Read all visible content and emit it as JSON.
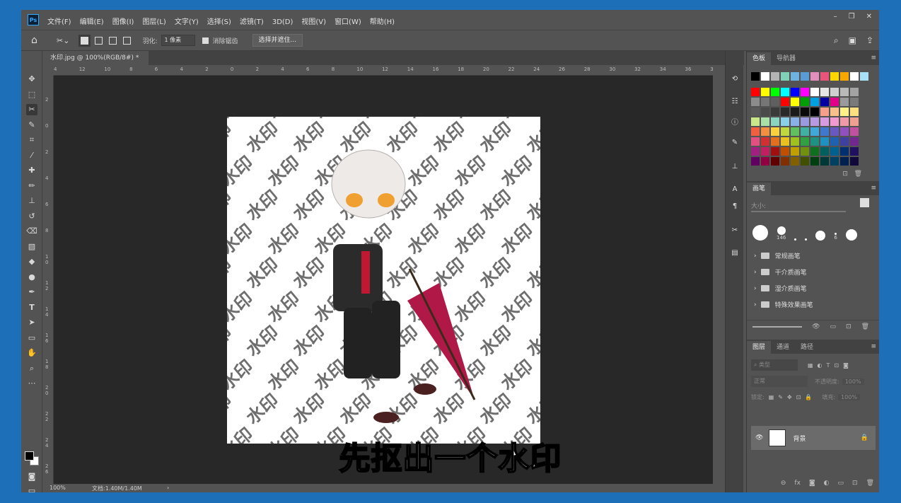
{
  "app": {
    "logo": "Ps",
    "menu": [
      "文件(F)",
      "编辑(E)",
      "图像(I)",
      "图层(L)",
      "文字(Y)",
      "选择(S)",
      "滤镜(T)",
      "3D(D)",
      "视图(V)",
      "窗口(W)",
      "帮助(H)"
    ]
  },
  "options": {
    "feather_label": "羽化:",
    "feather_value": "1 像素",
    "antialias_label": "消除锯齿",
    "select_mask_button": "选择并遮住..."
  },
  "document": {
    "tab_title": "水印.jpg @ 100%(RGB/8#) *",
    "zoom": "100%",
    "doc_size": "文档:1.40M/1.40M",
    "watermark_text": "水印"
  },
  "ruler_h": [
    "4",
    "12",
    "10",
    "8",
    "6",
    "4",
    "2",
    "0",
    "2",
    "4",
    "6",
    "8",
    "10",
    "12",
    "14",
    "16",
    "18",
    "20",
    "22",
    "24",
    "26",
    "28",
    "30",
    "32",
    "34",
    "36",
    "3"
  ],
  "ruler_v": [
    "2",
    "0",
    "2",
    "4",
    "6",
    "8",
    "1 0",
    "1 2",
    "1 4",
    "1 6",
    "1 8",
    "2 0",
    "2 2",
    "2 4",
    "2 6"
  ],
  "swatches_panel": {
    "tabs": [
      "色板",
      "导航器"
    ],
    "top_row": [
      "#000000",
      "#ffffff",
      "#b4b4b4",
      "#7fd1b8",
      "#6fb2e2",
      "#5a9bd5",
      "#e38fbd",
      "#e8557b",
      "#ffd500",
      "#f7a700",
      "#ffffff",
      "#a7e0f7"
    ],
    "grid": [
      [
        "#ff0000",
        "#ffff00",
        "#00ff00",
        "#00ffff",
        "#0000ff",
        "#ff00ff",
        "#ffffff",
        "#e6e6e6",
        "#d0d0d0",
        "#b9b9b9",
        "#a3a3a3"
      ],
      [
        "#8c8c8c",
        "#767676",
        "#5f5f5f",
        "#ff0000",
        "#ffff00",
        "#00a000",
        "#00a0e0",
        "#0000a0",
        "#e0008a",
        "#9a9a9a",
        "#7a7a7a"
      ],
      [
        "#5a5a5a",
        "#4a4a4a",
        "#3a3a3a",
        "#2a2a2a",
        "#1a1a1a",
        "#0a0a0a",
        "#000000",
        "#f4a08a",
        "#f8c08a",
        "#fff08a",
        "#ffe080"
      ],
      [
        "#c8e88a",
        "#a8e0a8",
        "#8ad4c0",
        "#8ad0e8",
        "#8ab0e8",
        "#9a9ae0",
        "#b89ae0",
        "#d89ae0",
        "#f09ad0",
        "#f09aa8",
        "#f0a090"
      ],
      [
        "#f06040",
        "#f09040",
        "#f8d040",
        "#c0d840",
        "#60c060",
        "#40b0a0",
        "#40a8d8",
        "#4078d0",
        "#6858c0",
        "#9050c0",
        "#c050a0"
      ],
      [
        "#e05080",
        "#d03030",
        "#e07020",
        "#e8c020",
        "#a0c020",
        "#30a040",
        "#209080",
        "#2090c0",
        "#2060b0",
        "#4040a0",
        "#702890"
      ],
      [
        "#a02080",
        "#c02060",
        "#a01010",
        "#c05000",
        "#c0a000",
        "#709010",
        "#107020",
        "#006060",
        "#006090",
        "#003070",
        "#201060"
      ],
      [
        "#600060",
        "#900040",
        "#600000",
        "#803000",
        "#806000",
        "#405000",
        "#004010",
        "#003838",
        "#004060",
        "#002050",
        "#100838"
      ]
    ]
  },
  "brush_panel": {
    "tab": "画笔",
    "size_label": "大小:",
    "presets": [
      "146",
      "6"
    ],
    "folders": [
      "常规画笔",
      "干介质画笔",
      "湿介质画笔",
      "特殊效果画笔"
    ]
  },
  "layers_panel": {
    "tabs": [
      "图层",
      "通道",
      "路径"
    ],
    "filter_placeholder": "类型",
    "blend_mode": "正常",
    "opacity_label": "不透明度:",
    "opacity_value": "100%",
    "lock_label": "锁定:",
    "fill_label": "填充:",
    "fill_value": "100%",
    "layer_name": "背景"
  },
  "subtitle": "先抠出一个水印"
}
